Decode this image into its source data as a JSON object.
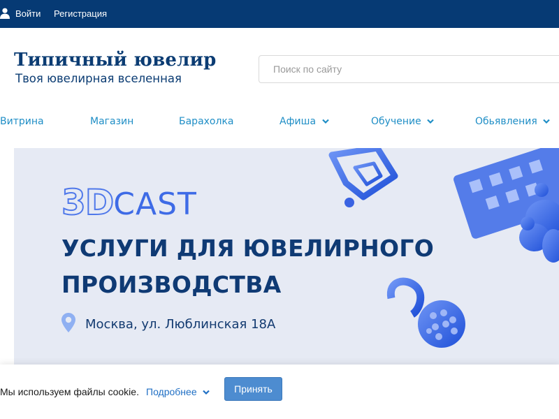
{
  "topbar": {
    "login_label": "Войти",
    "register_label": "Регистрация",
    "background": "#063a74"
  },
  "header": {
    "site_title": "Типичный ювелир",
    "tagline": "Твоя ювелирная вселенная",
    "search_placeholder": "Поиск по сайту"
  },
  "nav": {
    "items": [
      {
        "label": "Витрина",
        "has_dropdown": false
      },
      {
        "label": "Магазин",
        "has_dropdown": false
      },
      {
        "label": "Барахолка",
        "has_dropdown": false
      },
      {
        "label": "Афиша",
        "has_dropdown": true
      },
      {
        "label": "Обучение",
        "has_dropdown": true
      },
      {
        "label": "Обьявления",
        "has_dropdown": true
      }
    ],
    "link_color": "#1f8ec6"
  },
  "banner": {
    "brand_3d": "3D",
    "brand_cast": "CAST",
    "headline_line1": "УСЛУГИ ДЛЯ ЮВЕЛИРНОГО",
    "headline_line2": "ПРОИЗВОДСТВА",
    "address": "Москва, ул. Люблинская 18А",
    "accent": "#3e6be6"
  },
  "cookie": {
    "text": "Мы используем файлы cookie.",
    "more_label": "Подробнее",
    "accept_label": "Принять",
    "button_color": "#4d8cd0"
  },
  "icons": {
    "user": "user-icon",
    "chevron": "chevron-down-icon",
    "location": "map-pin-icon"
  }
}
